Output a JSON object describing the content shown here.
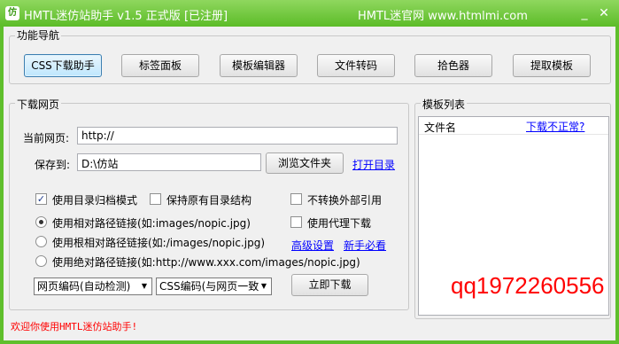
{
  "window": {
    "title": "HMTL迷仿站助手 v1.5 正式版 [已注册]",
    "site": "HMTL迷官网 www.htmlmi.com",
    "icon": "app-logo-icon",
    "accent_color": "#5fbf2c"
  },
  "nav_group": {
    "title": "功能导航",
    "buttons": [
      "CSS下载助手",
      "标签面板",
      "模板编辑器",
      "文件转码",
      "拾色器",
      "提取模板"
    ],
    "active_index": 0
  },
  "download_group": {
    "title": "下载网页",
    "url_label": "当前网页:",
    "url_value": "http://",
    "save_label": "保存到:",
    "save_value": "D:\\仿站",
    "browse_button": "浏览文件夹",
    "open_dir_link": "打开目录",
    "checkboxes": [
      {
        "label": "使用目录归档模式",
        "checked": true
      },
      {
        "label": "保持原有目录结构",
        "checked": false
      },
      {
        "label": "不转换外部引用",
        "checked": false
      },
      {
        "label": "使用代理下载",
        "checked": false
      }
    ],
    "radios": [
      {
        "label": "使用相对路径链接(如:images/nopic.jpg)",
        "selected": true
      },
      {
        "label": "使用根相对路径链接(如:/images/nopic.jpg)",
        "selected": false
      },
      {
        "label": "使用绝对路径链接(如:http://www.xxx.com/images/nopic.jpg)",
        "selected": false
      }
    ],
    "advanced_link": "高级设置",
    "newbie_link": "新手必看",
    "page_encoding": "网页编码(自动检测)",
    "css_encoding": "CSS编码(与网页一致",
    "download_button": "立即下载"
  },
  "template_group": {
    "title": "模板列表",
    "column_header": "文件名",
    "problem_link": "下载不正常?"
  },
  "watermark": "qq1972260556",
  "status_text": "欢迎你使用HMTL迷仿站助手!"
}
